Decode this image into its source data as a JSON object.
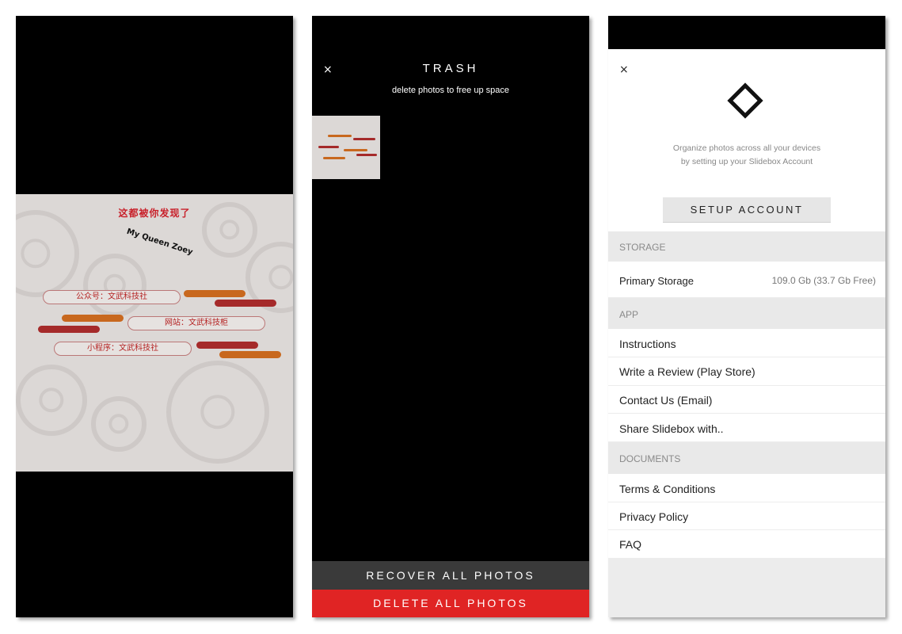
{
  "panel1": {
    "poster": {
      "title": "这都被你发现了",
      "subtitle": "My Queen Zoey",
      "pills": [
        "公众号：文武科技社",
        "网站：文武科技柜",
        "小程序：文武科技社"
      ],
      "colors": {
        "background": "#dcd8d6",
        "accent_red": "#a52a2a",
        "accent_orange": "#c8681e",
        "text_red": "#c8202a"
      }
    }
  },
  "panel2": {
    "close_icon": "×",
    "title": "TRASH",
    "subtitle": "delete photos to free up space",
    "recover_label": "RECOVER ALL PHOTOS",
    "delete_label": "DELETE ALL PHOTOS",
    "colors": {
      "delete": "#e02424",
      "recover": "#3a3a3a"
    }
  },
  "panel3": {
    "close_icon": "×",
    "organize_text": "Organize photos across all your devices by setting up your Slidebox Account",
    "setup_label": "SETUP ACCOUNT",
    "storage": {
      "header": "STORAGE",
      "label": "Primary Storage",
      "value": "109.0 Gb (33.7 Gb Free)"
    },
    "app": {
      "header": "APP",
      "items": [
        "Instructions",
        "Write a Review (Play Store)",
        "Contact Us (Email)",
        "Share Slidebox with.."
      ]
    },
    "documents": {
      "header": "DOCUMENTS",
      "items": [
        "Terms & Conditions",
        "Privacy Policy",
        "FAQ"
      ]
    }
  }
}
